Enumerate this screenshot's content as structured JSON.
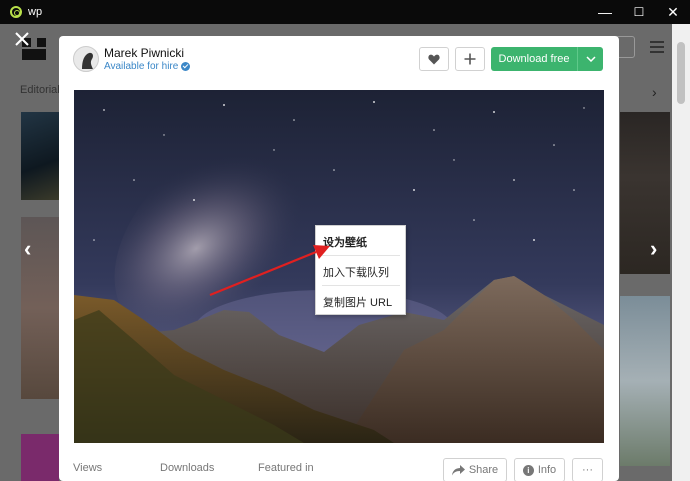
{
  "window": {
    "title": "wp",
    "controls": {
      "minimize": "—",
      "maximize": "☐",
      "close": "✕"
    }
  },
  "background_page": {
    "editorial_label": "Editorial"
  },
  "modal": {
    "author": {
      "name": "Marek Piwnicki",
      "status": "Available for hire"
    },
    "actions": {
      "download": "Download free"
    },
    "stats": {
      "views": "Views",
      "downloads": "Downloads",
      "featured": "Featured in"
    },
    "footer_buttons": {
      "share": "Share",
      "info": "Info",
      "more": "···"
    }
  },
  "context_menu": {
    "items": [
      "设为壁纸",
      "加入下载队列",
      "复制图片 URL"
    ]
  },
  "colors": {
    "accent_green": "#3cb46e",
    "link_blue": "#3b87c7",
    "arrow_red": "#e02020"
  }
}
